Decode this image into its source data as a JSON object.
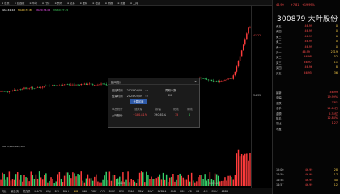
{
  "toolbar": {
    "items": [
      "首页",
      "自选股",
      "市场",
      "行情",
      "资讯",
      "交易",
      "理财",
      "社区",
      "研报",
      "数据",
      "工具"
    ]
  },
  "chart": {
    "ma_legend": [
      {
        "label": "MA5:",
        "value": "41.22",
        "color": "#ffffff"
      },
      {
        "label": "MA10:",
        "value": "37.88",
        "color": "#ffd24a"
      },
      {
        "label": "MA20:",
        "value": "34.05",
        "color": "#ff55ff"
      },
      {
        "label": "MA60:",
        "value": "27.45",
        "color": "#3fd15e"
      }
    ],
    "price_labels": [
      "41.22",
      "34.35"
    ],
    "volume_legend": "VOL 1,205,628,501",
    "date_labels": [
      "2025",
      "2025-05"
    ],
    "colors": {
      "up": "#ff3b3b",
      "down": "#36d16a",
      "ma5": "#ffffff",
      "ma10": "#ffd24a",
      "ma20": "#ff55ff",
      "ma60": "#3fd15e",
      "accent": "#2e5aa8"
    }
  },
  "popup": {
    "title": "区间统计",
    "close_label": "×",
    "start_label": "起始时间",
    "start_value": "2025/04/09",
    "start_arrows": "‹ ›",
    "end_label": "结束时间",
    "end_value": "2025/05/09",
    "end_arrows": "‹ ›",
    "days_label": "周期个数",
    "days_value": "20",
    "calc_button": "计算区间",
    "columns": [
      "单品统计",
      "涨跌幅",
      "振幅",
      "阳线",
      "阴线"
    ],
    "row": {
      "name": "大叶股份",
      "change": "+180.81%",
      "amplitude": "190.61%",
      "up_days": "15",
      "down_days": "4"
    }
  },
  "bottom_bar": {
    "items": [
      "均线",
      "资金流",
      "成交量",
      "MACD",
      "KDJ",
      "RSI",
      "BOLL",
      "WR",
      "DMI",
      "OBV",
      "CCI",
      "BIAS",
      "PSY",
      "DMA",
      "TRIX",
      "ROC",
      "EXPMA",
      "SAR",
      "BBI",
      "CR",
      "VR",
      "ASI",
      "EMV",
      "ARBR"
    ],
    "active_index": 7
  },
  "side_panel": {
    "code": "300879",
    "name": "大叶股份",
    "price": "46.99",
    "change": "+7.81",
    "change_pct": "+19.99%",
    "orders": [
      {
        "label": "卖五",
        "price": "46.99",
        "vol": "0"
      },
      {
        "label": "卖四",
        "price": "46.99",
        "vol": "0"
      },
      {
        "label": "卖三",
        "price": "46.99",
        "vol": "0"
      },
      {
        "label": "卖二",
        "price": "46.99",
        "vol": "0"
      },
      {
        "label": "卖一",
        "price": "46.99",
        "vol": "0"
      },
      {
        "label": "买一",
        "price": "46.99",
        "vol": "2319"
      },
      {
        "label": "买二",
        "price": "46.98",
        "vol": "52"
      },
      {
        "label": "买三",
        "price": "46.97",
        "vol": "11"
      },
      {
        "label": "买四",
        "price": "46.96",
        "vol": "8"
      },
      {
        "label": "买五",
        "price": "46.95",
        "vol": "36"
      }
    ],
    "stats": [
      {
        "label": "最新",
        "value": "46.99"
      },
      {
        "label": "涨幅",
        "value": "19.99%"
      },
      {
        "label": "涨跌",
        "value": "7.81"
      },
      {
        "label": "总手",
        "value": "12.05万"
      },
      {
        "label": "金额",
        "value": "5.33亿"
      },
      {
        "label": "换手",
        "value": "12.86%"
      },
      {
        "label": "量比",
        "value": "1.27"
      },
      {
        "label": "市盈",
        "value": "-"
      }
    ],
    "ticks": [
      {
        "time": "15:00",
        "price": "46.99",
        "vol": "28"
      },
      {
        "time": "14:59",
        "price": "46.99",
        "vol": "17"
      },
      {
        "time": "14:58",
        "price": "46.99",
        "vol": "40"
      },
      {
        "time": "14:57",
        "price": "46.99",
        "vol": "12"
      }
    ]
  }
}
